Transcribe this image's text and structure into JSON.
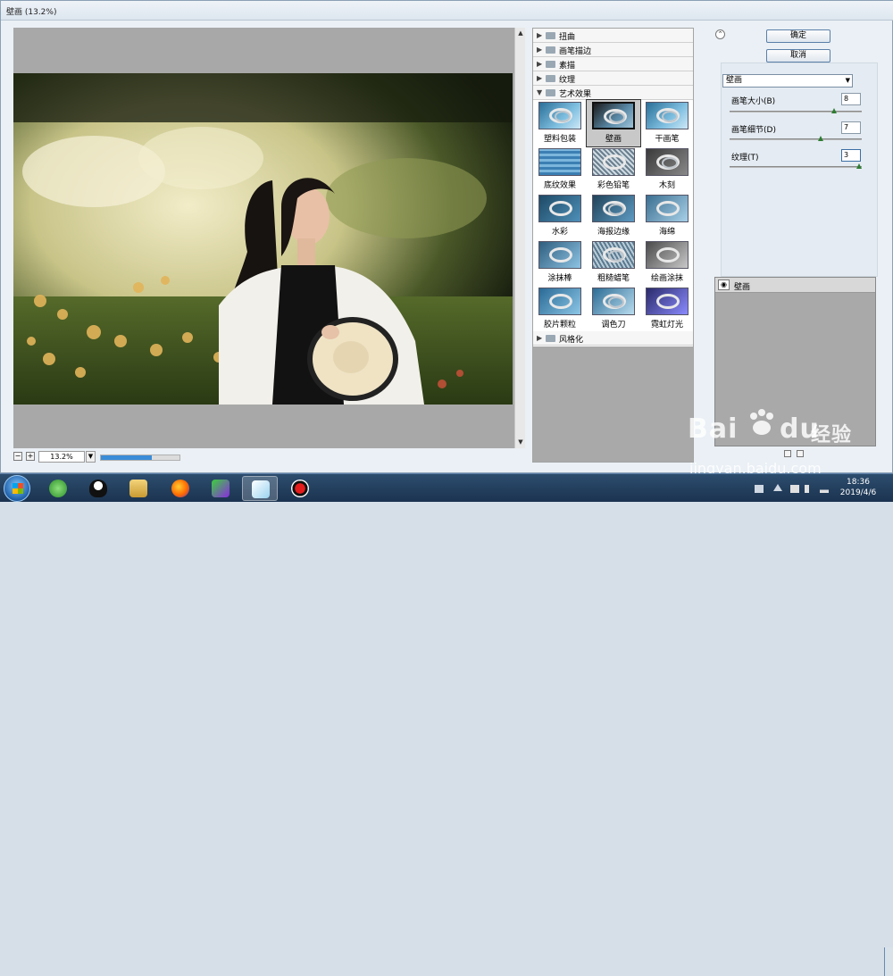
{
  "window": {
    "title": "壁画 (13.2%)"
  },
  "preview": {
    "zoom": "13.2%",
    "zoom_out": "−",
    "zoom_in": "+",
    "progress": 0.65
  },
  "filter_gallery": {
    "categories_top": [
      "扭曲",
      "画笔描边",
      "素描",
      "纹理"
    ],
    "open_category": "艺术效果",
    "thumbnails": [
      "塑料包装",
      "壁画",
      "干画笔",
      "底纹效果",
      "彩色铅笔",
      "木刻",
      "水彩",
      "海报边缘",
      "海绵",
      "涂抹棒",
      "粗糙蜡笔",
      "绘画涂抹",
      "胶片颗粒",
      "调色刀",
      "霓虹灯光"
    ],
    "selected": "壁画",
    "categories_bottom": [
      "风格化"
    ]
  },
  "buttons": {
    "ok": "确定",
    "cancel": "取消",
    "collapse": "⌃"
  },
  "settings": {
    "filter_select": "壁画",
    "params": [
      {
        "label": "画笔大小(B)",
        "value": "8",
        "fraction": 0.8
      },
      {
        "label": "画笔细节(D)",
        "value": "7",
        "fraction": 0.7
      },
      {
        "label": "纹理(T)",
        "value": "3",
        "fraction": 1.0
      }
    ]
  },
  "layers": {
    "items": [
      "壁画"
    ]
  },
  "watermark": {
    "brand": "Bai",
    "brand2": "du",
    "cn": "经验",
    "url": "jingyan.baidu.com"
  },
  "taskbar": {
    "time": "18:36",
    "date": "2019/4/6"
  },
  "colors": {
    "accent": "#3a8cd8",
    "knob": "#2e7d32",
    "taskbar": "#1b3350"
  }
}
